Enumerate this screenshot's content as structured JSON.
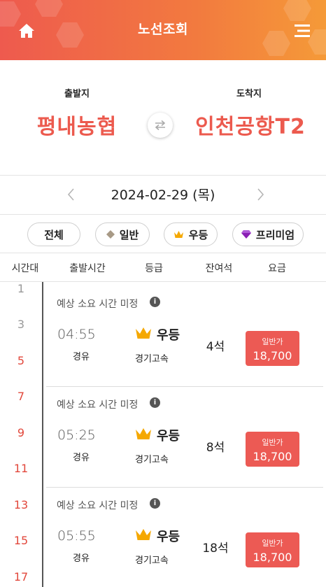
{
  "header": {
    "title": "노선조회",
    "home_icon": "home-icon",
    "menu_icon": "hamburger-menu-icon",
    "gradient_colors": [
      "#ee5a4e",
      "#f59a38"
    ]
  },
  "route": {
    "departure_label": "출발지",
    "departure_name": "평내농협",
    "arrival_label": "도착지",
    "arrival_name": "인천공항T2",
    "swap_icon": "swap-arrows-icon",
    "accent_color": "#ec5a4e"
  },
  "date_nav": {
    "date": "2024-02-29 (목)",
    "prev_icon": "chevron-left-icon",
    "next_icon": "chevron-right-icon"
  },
  "filters": [
    {
      "label": "전체",
      "icon": ""
    },
    {
      "label": "일반",
      "icon": "diamond-icon"
    },
    {
      "label": "우등",
      "icon": "crown-icon"
    },
    {
      "label": "프리미엄",
      "icon": "gem-icon"
    }
  ],
  "columns": [
    "시간대",
    "출발시간",
    "등급",
    "잔여석",
    "요금"
  ],
  "timeline": {
    "hours": [
      "1",
      "3",
      "5",
      "7",
      "9",
      "11",
      "13",
      "15",
      "17"
    ],
    "active_color": "#e2483c",
    "inactive_color": "#999999"
  },
  "buses": [
    {
      "estimate": "예상 소요 시간 미정",
      "departure": "04:55",
      "via": "경유",
      "grade": "우등",
      "company": "경기고속",
      "seats": "4석",
      "fare_type": "일반가",
      "fare": "18,700"
    },
    {
      "estimate": "예상 소요 시간 미정",
      "departure": "05:25",
      "via": "경유",
      "grade": "우등",
      "company": "경기고속",
      "seats": "8석",
      "fare_type": "일반가",
      "fare": "18,700"
    },
    {
      "estimate": "예상 소요 시간 미정",
      "departure": "05:55",
      "via": "경유",
      "grade": "우등",
      "company": "경기고속",
      "seats": "18석",
      "fare_type": "일반가",
      "fare": "18,700"
    }
  ]
}
